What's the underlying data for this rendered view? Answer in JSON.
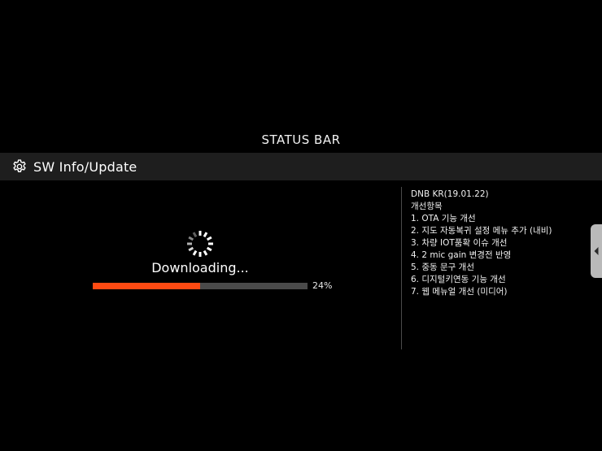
{
  "status_bar": {
    "label": "STATUS BAR"
  },
  "header": {
    "icon": "gear-icon",
    "title": "SW Info/Update"
  },
  "download": {
    "spinner_icon": "loading-spinner-icon",
    "status_text": "Downloading...",
    "progress_fraction": 0.5,
    "progress_percent_text": "24%",
    "accent_color": "#ff4a12",
    "track_color": "#4a4a4a"
  },
  "release_notes": {
    "version": "DNB KR(19.01.22)",
    "section_title": "개선항목",
    "items": [
      "1. OTA 기능 개선",
      "2. 지도 자동복귀 설정 메뉴 추가 (내비)",
      "3. 차량 IOT품확 이슈 개선",
      "4. 2 mic gain 변경전 반영",
      "5. 중동 문구 개선",
      "6. 디지털키연동 기능 개선",
      "7. 웹 메뉴얼 개선 (미디어)"
    ]
  },
  "side_handle": {
    "icon": "chevron-left-icon"
  }
}
